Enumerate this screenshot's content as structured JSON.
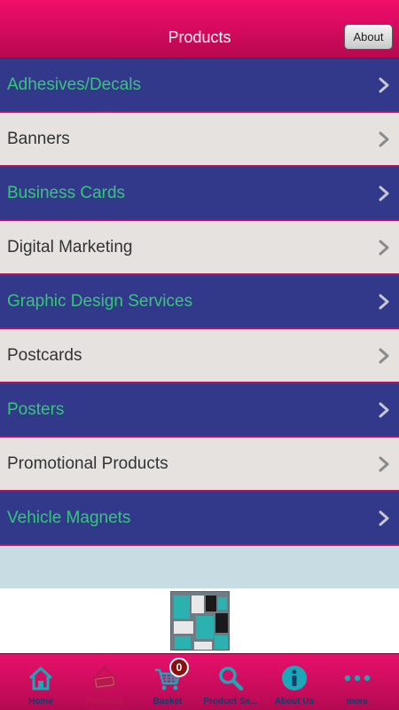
{
  "header": {
    "title": "Products",
    "about_label": "About"
  },
  "products": [
    {
      "label": "Adhesives/Decals"
    },
    {
      "label": "Banners"
    },
    {
      "label": "Business Cards"
    },
    {
      "label": "Digital Marketing"
    },
    {
      "label": "Graphic Design Services"
    },
    {
      "label": "Postcards"
    },
    {
      "label": "Posters"
    },
    {
      "label": "Promotional Products"
    },
    {
      "label": "Vehicle Magnets"
    }
  ],
  "tabs": [
    {
      "label": "Home",
      "icon": "home-icon"
    },
    {
      "label": "Products",
      "icon": "open-sign-icon",
      "active": true
    },
    {
      "label": "Basket",
      "icon": "basket-icon",
      "badge": "0"
    },
    {
      "label": "Product Se...",
      "icon": "search-icon"
    },
    {
      "label": "About Us",
      "icon": "info-icon"
    },
    {
      "label": "more",
      "icon": "more-icon"
    }
  ],
  "colors": {
    "header": "#d80a60",
    "row_blue": "#33398a",
    "row_grey": "#e6e2df",
    "label_green": "#34c77a",
    "tab_icon": "#1aa7b8"
  }
}
